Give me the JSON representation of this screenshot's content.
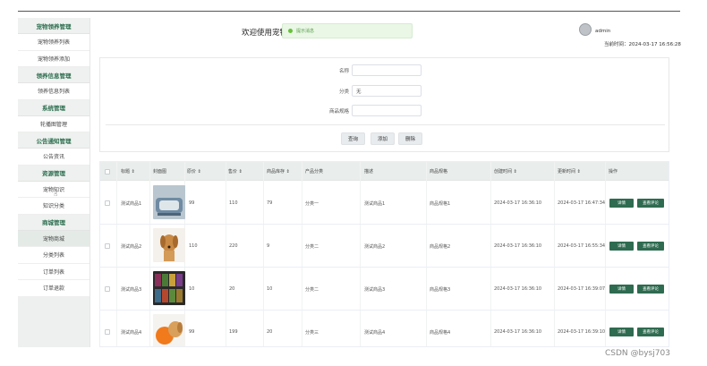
{
  "header": {
    "welcome": "欢迎使用宠物~",
    "toast": "提示消息",
    "user": "admin",
    "time_label": "当前时间：",
    "time_value": "2024-03-17 16:56:28"
  },
  "sidebar": [
    {
      "group": "宠物领养管理",
      "items": [
        "宠物领养列表",
        "宠物领养添加"
      ]
    },
    {
      "group": "领养信息管理",
      "items": [
        "领养信息列表"
      ]
    },
    {
      "group": "系统管理",
      "items": [
        "轮播图管理"
      ]
    },
    {
      "group": "公告通知管理",
      "items": [
        "公告资讯"
      ]
    },
    {
      "group": "资源管理",
      "items": [
        "宠物知识",
        "知识分类"
      ]
    },
    {
      "group": "商城管理",
      "items": [
        "宠物商城",
        "分类列表",
        "订单列表",
        "订单退款"
      ]
    }
  ],
  "filters": {
    "name_label": "名称",
    "name_value": "",
    "category_label": "分类",
    "category_value": "无",
    "spec_label": "商品规格",
    "spec_value": "",
    "search_button": "查询",
    "add_button": "添加",
    "delete_button": "删除"
  },
  "table": {
    "columns": [
      "标题",
      "封面图",
      "原价",
      "售价",
      "商品库存",
      "产品分类",
      "描述",
      "商品规格",
      "创建时间",
      "更新时间",
      "操作"
    ],
    "rows": [
      {
        "title": "测试商品1",
        "original_price": "99",
        "price": "110",
        "stock": "79",
        "category": "分类一",
        "desc": "测试商品1",
        "spec": "商品规格1",
        "created": "2024-03-17 16:36:10",
        "updated": "2024-03-17 16:47:34"
      },
      {
        "title": "测试商品2",
        "original_price": "110",
        "price": "220",
        "stock": "9",
        "category": "分类二",
        "desc": "测试商品2",
        "spec": "商品规格2",
        "created": "2024-03-17 16:36:10",
        "updated": "2024-03-17 16:55:34"
      },
      {
        "title": "测试商品3",
        "original_price": "10",
        "price": "20",
        "stock": "10",
        "category": "分类二",
        "desc": "测试商品3",
        "spec": "商品规格3",
        "created": "2024-03-17 16:36:10",
        "updated": "2024-03-17 16:39:07"
      },
      {
        "title": "测试商品4",
        "original_price": "99",
        "price": "199",
        "stock": "20",
        "category": "分类三",
        "desc": "测试商品4",
        "spec": "商品规格4",
        "created": "2024-03-17 16:36:10",
        "updated": "2024-03-17 16:39:10"
      }
    ],
    "edit_label": "详情",
    "review_label": "查看评论"
  },
  "watermark": "CSDN @bysj703",
  "colors": {
    "accent": "#2f6b50",
    "header_bg": "#e9eeec",
    "toast_bg": "#eaf6e6"
  }
}
